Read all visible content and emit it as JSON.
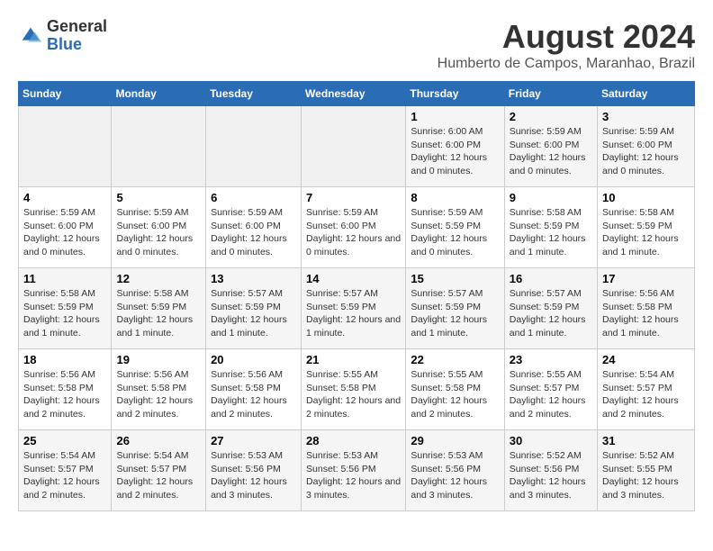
{
  "header": {
    "logo_general": "General",
    "logo_blue": "Blue",
    "title": "August 2024",
    "location": "Humberto de Campos, Maranhao, Brazil"
  },
  "columns": [
    "Sunday",
    "Monday",
    "Tuesday",
    "Wednesday",
    "Thursday",
    "Friday",
    "Saturday"
  ],
  "weeks": [
    {
      "days": [
        {
          "number": "",
          "info": ""
        },
        {
          "number": "",
          "info": ""
        },
        {
          "number": "",
          "info": ""
        },
        {
          "number": "",
          "info": ""
        },
        {
          "number": "1",
          "info": "Sunrise: 6:00 AM\nSunset: 6:00 PM\nDaylight: 12 hours and 0 minutes."
        },
        {
          "number": "2",
          "info": "Sunrise: 5:59 AM\nSunset: 6:00 PM\nDaylight: 12 hours and 0 minutes."
        },
        {
          "number": "3",
          "info": "Sunrise: 5:59 AM\nSunset: 6:00 PM\nDaylight: 12 hours and 0 minutes."
        }
      ]
    },
    {
      "days": [
        {
          "number": "4",
          "info": "Sunrise: 5:59 AM\nSunset: 6:00 PM\nDaylight: 12 hours and 0 minutes."
        },
        {
          "number": "5",
          "info": "Sunrise: 5:59 AM\nSunset: 6:00 PM\nDaylight: 12 hours and 0 minutes."
        },
        {
          "number": "6",
          "info": "Sunrise: 5:59 AM\nSunset: 6:00 PM\nDaylight: 12 hours and 0 minutes."
        },
        {
          "number": "7",
          "info": "Sunrise: 5:59 AM\nSunset: 6:00 PM\nDaylight: 12 hours and 0 minutes."
        },
        {
          "number": "8",
          "info": "Sunrise: 5:59 AM\nSunset: 5:59 PM\nDaylight: 12 hours and 0 minutes."
        },
        {
          "number": "9",
          "info": "Sunrise: 5:58 AM\nSunset: 5:59 PM\nDaylight: 12 hours and 1 minute."
        },
        {
          "number": "10",
          "info": "Sunrise: 5:58 AM\nSunset: 5:59 PM\nDaylight: 12 hours and 1 minute."
        }
      ]
    },
    {
      "days": [
        {
          "number": "11",
          "info": "Sunrise: 5:58 AM\nSunset: 5:59 PM\nDaylight: 12 hours and 1 minute."
        },
        {
          "number": "12",
          "info": "Sunrise: 5:58 AM\nSunset: 5:59 PM\nDaylight: 12 hours and 1 minute."
        },
        {
          "number": "13",
          "info": "Sunrise: 5:57 AM\nSunset: 5:59 PM\nDaylight: 12 hours and 1 minute."
        },
        {
          "number": "14",
          "info": "Sunrise: 5:57 AM\nSunset: 5:59 PM\nDaylight: 12 hours and 1 minute."
        },
        {
          "number": "15",
          "info": "Sunrise: 5:57 AM\nSunset: 5:59 PM\nDaylight: 12 hours and 1 minute."
        },
        {
          "number": "16",
          "info": "Sunrise: 5:57 AM\nSunset: 5:59 PM\nDaylight: 12 hours and 1 minute."
        },
        {
          "number": "17",
          "info": "Sunrise: 5:56 AM\nSunset: 5:58 PM\nDaylight: 12 hours and 1 minute."
        }
      ]
    },
    {
      "days": [
        {
          "number": "18",
          "info": "Sunrise: 5:56 AM\nSunset: 5:58 PM\nDaylight: 12 hours and 2 minutes."
        },
        {
          "number": "19",
          "info": "Sunrise: 5:56 AM\nSunset: 5:58 PM\nDaylight: 12 hours and 2 minutes."
        },
        {
          "number": "20",
          "info": "Sunrise: 5:56 AM\nSunset: 5:58 PM\nDaylight: 12 hours and 2 minutes."
        },
        {
          "number": "21",
          "info": "Sunrise: 5:55 AM\nSunset: 5:58 PM\nDaylight: 12 hours and 2 minutes."
        },
        {
          "number": "22",
          "info": "Sunrise: 5:55 AM\nSunset: 5:58 PM\nDaylight: 12 hours and 2 minutes."
        },
        {
          "number": "23",
          "info": "Sunrise: 5:55 AM\nSunset: 5:57 PM\nDaylight: 12 hours and 2 minutes."
        },
        {
          "number": "24",
          "info": "Sunrise: 5:54 AM\nSunset: 5:57 PM\nDaylight: 12 hours and 2 minutes."
        }
      ]
    },
    {
      "days": [
        {
          "number": "25",
          "info": "Sunrise: 5:54 AM\nSunset: 5:57 PM\nDaylight: 12 hours and 2 minutes."
        },
        {
          "number": "26",
          "info": "Sunrise: 5:54 AM\nSunset: 5:57 PM\nDaylight: 12 hours and 2 minutes."
        },
        {
          "number": "27",
          "info": "Sunrise: 5:53 AM\nSunset: 5:56 PM\nDaylight: 12 hours and 3 minutes."
        },
        {
          "number": "28",
          "info": "Sunrise: 5:53 AM\nSunset: 5:56 PM\nDaylight: 12 hours and 3 minutes."
        },
        {
          "number": "29",
          "info": "Sunrise: 5:53 AM\nSunset: 5:56 PM\nDaylight: 12 hours and 3 minutes."
        },
        {
          "number": "30",
          "info": "Sunrise: 5:52 AM\nSunset: 5:56 PM\nDaylight: 12 hours and 3 minutes."
        },
        {
          "number": "31",
          "info": "Sunrise: 5:52 AM\nSunset: 5:55 PM\nDaylight: 12 hours and 3 minutes."
        }
      ]
    }
  ]
}
